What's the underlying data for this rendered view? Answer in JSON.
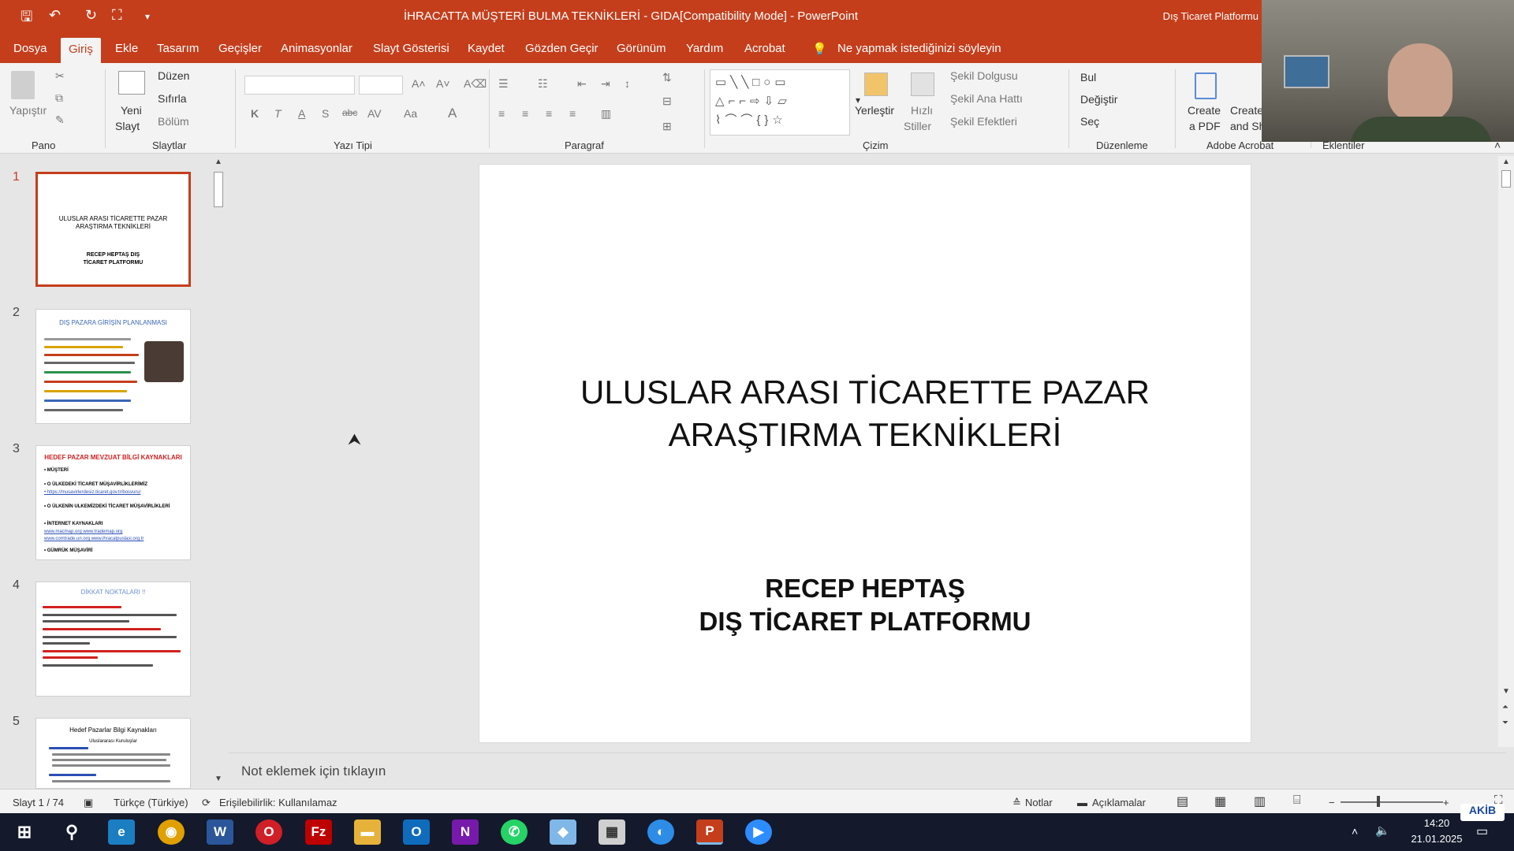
{
  "window": {
    "title": "İHRACATTA MÜŞTERİ BULMA TEKNİKLERİ - GIDA[Compatibility Mode] - PowerPoint",
    "platform": "Dış Ticaret Platformu"
  },
  "menu": {
    "items": [
      "Dosya",
      "Giriş",
      "Ekle",
      "Tasarım",
      "Geçişler",
      "Animasyonlar",
      "Slayt Gösterisi",
      "Kaydet",
      "Gözden Geçir",
      "Görünüm",
      "Yardım",
      "Acrobat"
    ],
    "tell_me": "Ne yapmak istediğinizi söyleyin"
  },
  "ribbon": {
    "groups": {
      "pano": "Pano",
      "slaytlar": "Slaytlar",
      "yazi_tipi": "Yazı Tipi",
      "paragraf": "Paragraf",
      "cizim": "Çizim",
      "duzenleme": "Düzenleme",
      "adobe": "Adobe Acrobat",
      "eklentiler": "Eklentiler"
    },
    "yapistir": "Yapıştır",
    "yeni": "Yeni",
    "slayt": "Slayt",
    "duzen": "Düzen",
    "sifirla": "Sıfırla",
    "bolum": "Bölüm",
    "yerlestir": "Yerleştir",
    "hizli": "Hızlı",
    "stiller": "Stiller",
    "sekil_dolgusu": "Şekil Dolgusu",
    "sekil_ana_hatti": "Şekil Ana Hattı",
    "sekil_efektleri": "Şekil Efektleri",
    "bul": "Bul",
    "degistir": "Değiştir",
    "sec": "Seç",
    "create_pdf_1": "Create",
    "create_pdf_2": "a PDF",
    "create_share_1": "Create",
    "create_share_2": "and Sh"
  },
  "thumbnails": [
    {
      "num": "1",
      "title": "ULUSLAR ARASI TİCARETTE PAZAR ARAŞTIRMA TEKNİKLERİ",
      "sub": "RECEP HEPTAŞ DIŞ TİCARET PLATFORMU"
    },
    {
      "num": "2",
      "title": "DIŞ PAZARA GİRİŞİN PLANLANMASI"
    },
    {
      "num": "3",
      "title": "HEDEF PAZAR MEVZUAT BİLGİ KAYNAKLARI",
      "lines": [
        "• MÜŞTERİ",
        "• O ÜLKEDEKİ TİCARET MÜŞAVİRLİKLERİMİZ",
        "• https://musavirlerdesiz.ticaret.gov.tr/bosvuru/",
        "• O ÜLKENİN ULKEMİZDEKİ TİCARET MÜŞAVİRLİKLERİ",
        "• İNTERNET KAYNAKLARI",
        "www.macmap.org www.trademap.org",
        "www.comtrade.un.org www.ihracatpuslasi.org.tr",
        "• GÜMRÜK MÜŞAVİRİ"
      ]
    },
    {
      "num": "4",
      "title": "DİKKAT NOKTALARI !!"
    },
    {
      "num": "5",
      "title": "Hedef Pazarlar Bilgi Kaynakları",
      "sub": "Uluslararası Kuruluşlar"
    }
  ],
  "slide": {
    "title_line1": "ULUSLAR ARASI TİCARETTE PAZAR",
    "title_line2": "ARAŞTIRMA TEKNİKLERİ",
    "author": "RECEP HEPTAŞ",
    "org": "DIŞ TİCARET PLATFORMU"
  },
  "notes": {
    "placeholder": "Not eklemek için tıklayın"
  },
  "status": {
    "slide": "Slayt 1 / 74",
    "language": "Türkçe (Türkiye)",
    "accessibility": "Erişilebilirlik: Kullanılamaz",
    "notes": "Notlar",
    "comments": "Açıklamalar"
  },
  "taskbar": {
    "time": "14:20",
    "date": "21.01.2025"
  },
  "webcam": {
    "logo": "AKİB"
  }
}
